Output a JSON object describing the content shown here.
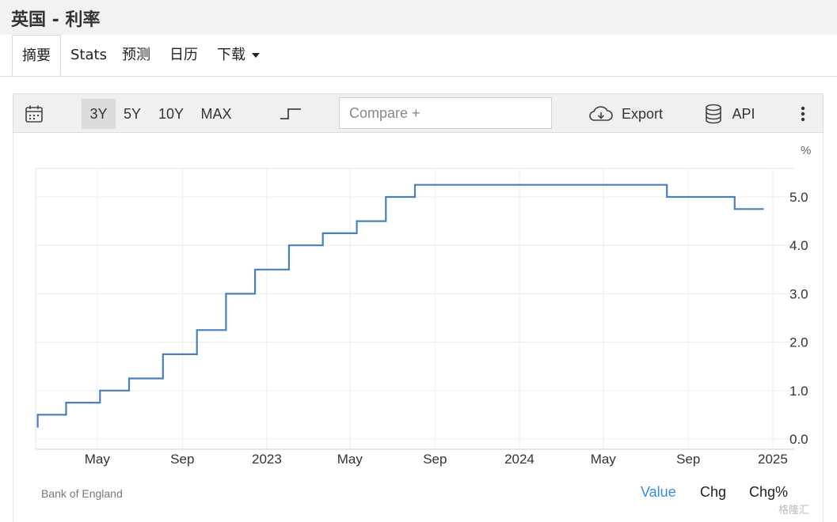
{
  "page": {
    "title": "英国 - 利率"
  },
  "tabs": [
    {
      "label": "摘要",
      "active": true
    },
    {
      "label": "Stats"
    },
    {
      "label": "预测"
    },
    {
      "label": "日历"
    },
    {
      "label": "下载",
      "dropdown": true
    }
  ],
  "toolbar": {
    "ranges": [
      "3Y",
      "5Y",
      "10Y",
      "MAX"
    ],
    "active_range": "3Y",
    "compare_placeholder": "Compare +",
    "export_label": "Export",
    "api_label": "API",
    "icons": [
      "calendar-icon",
      "step-chart-icon",
      "cloud-download-icon",
      "database-icon",
      "more-vertical-icon"
    ]
  },
  "footer": {
    "source": "Bank of England",
    "value_tabs": [
      "Value",
      "Chg",
      "Chg%"
    ],
    "active_value_tab": "Value",
    "watermark": "格隆汇"
  },
  "colors": {
    "line": "#4a7fb8",
    "active_tab_text": "#3a8cd8"
  },
  "chart_data": {
    "type": "line",
    "step": true,
    "unit_label": "%",
    "x_start": "2022-02",
    "x_end": "2024-12",
    "x_ticks": [
      {
        "date": "2022-05-01",
        "label": "May"
      },
      {
        "date": "2022-09-01",
        "label": "Sep"
      },
      {
        "date": "2023-01-01",
        "label": "2023"
      },
      {
        "date": "2023-05-01",
        "label": "May"
      },
      {
        "date": "2023-09-01",
        "label": "Sep"
      },
      {
        "date": "2024-01-01",
        "label": "2024"
      },
      {
        "date": "2024-05-01",
        "label": "May"
      },
      {
        "date": "2024-09-01",
        "label": "Sep"
      },
      {
        "date": "2025-01-01",
        "label": "2025"
      }
    ],
    "y_ticks": [
      "0.0",
      "1.0",
      "2.0",
      "3.0",
      "4.0",
      "5.0"
    ],
    "ylim": [
      -0.2,
      5.7
    ],
    "grid": true,
    "series": [
      {
        "points": [
          {
            "date": "2022-02-03",
            "value": 0.25
          },
          {
            "date": "2022-02-04",
            "value": 0.5
          },
          {
            "date": "2022-03-17",
            "value": 0.75
          },
          {
            "date": "2022-05-05",
            "value": 1.0
          },
          {
            "date": "2022-06-16",
            "value": 1.25
          },
          {
            "date": "2022-08-04",
            "value": 1.75
          },
          {
            "date": "2022-09-22",
            "value": 2.25
          },
          {
            "date": "2022-11-03",
            "value": 3.0
          },
          {
            "date": "2022-12-15",
            "value": 3.5
          },
          {
            "date": "2023-02-02",
            "value": 4.0
          },
          {
            "date": "2023-03-23",
            "value": 4.25
          },
          {
            "date": "2023-05-11",
            "value": 4.5
          },
          {
            "date": "2023-06-22",
            "value": 5.0
          },
          {
            "date": "2023-08-03",
            "value": 5.25
          },
          {
            "date": "2024-08-01",
            "value": 5.0
          },
          {
            "date": "2024-11-07",
            "value": 4.75
          },
          {
            "date": "2024-12-19",
            "value": 4.75
          }
        ]
      }
    ]
  }
}
